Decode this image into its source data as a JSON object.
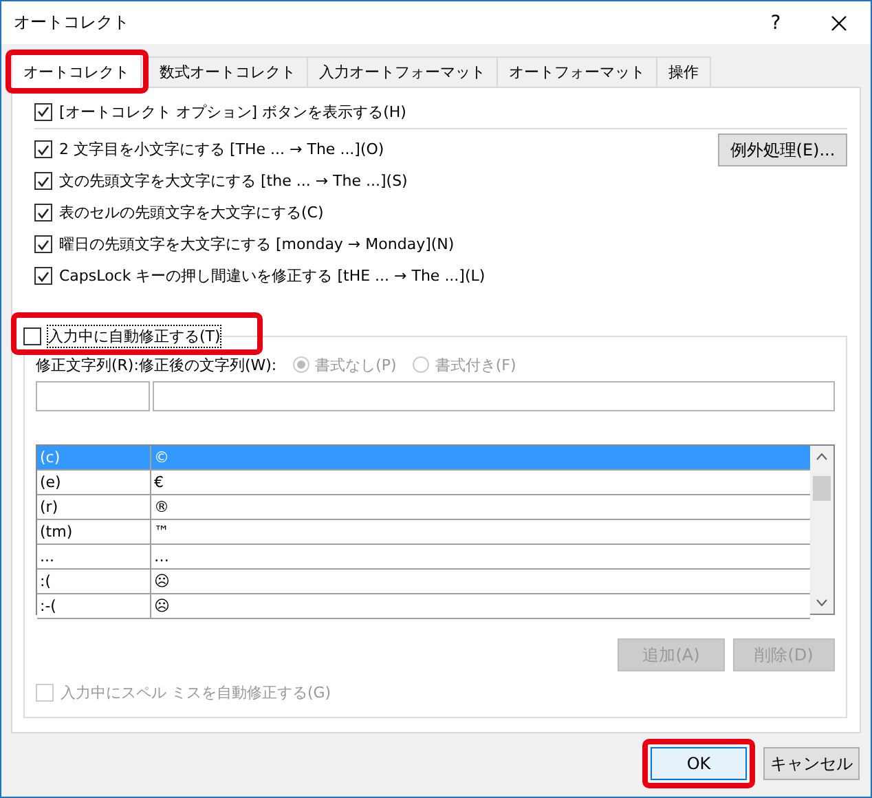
{
  "window": {
    "title": "オートコレクト",
    "help": "?"
  },
  "tabs": [
    {
      "label": "オートコレクト",
      "selected": true,
      "highlighted": true
    },
    {
      "label": "数式オートコレクト",
      "selected": false,
      "highlighted": false
    },
    {
      "label": "入力オートフォーマット",
      "selected": false,
      "highlighted": false
    },
    {
      "label": "オートフォーマット",
      "selected": false,
      "highlighted": false
    },
    {
      "label": "操作",
      "selected": false,
      "highlighted": false
    }
  ],
  "show_options_button": {
    "label": "[オートコレクト オプション] ボタンを表示する(H)",
    "checked": true
  },
  "options": [
    {
      "label": "2 文字目を小文字にする [THe ... → The ...](O)",
      "checked": true
    },
    {
      "label": "文の先頭文字を大文字にする [the ... → The ...](S)",
      "checked": true
    },
    {
      "label": "表のセルの先頭文字を大文字にする(C)",
      "checked": true
    },
    {
      "label": "曜日の先頭文字を大文字にする [monday →  Monday](N)",
      "checked": true
    },
    {
      "label": "CapsLock キーの押し間違いを修正する [tHE ... → The ...](L)",
      "checked": true
    }
  ],
  "exceptions_button": "例外処理(E)...",
  "replace_group": {
    "label": "入力中に自動修正する(T)",
    "checked": false,
    "highlighted": true,
    "replace_label": "修正文字列(R):",
    "with_label": "修正後の文字列(W):",
    "format_options": [
      {
        "label": "書式なし(P)",
        "selected": true
      },
      {
        "label": "書式付き(F)",
        "selected": false
      }
    ],
    "entries": [
      {
        "from": "(c)",
        "to": "©",
        "selected": true
      },
      {
        "from": "(e)",
        "to": "€",
        "selected": false
      },
      {
        "from": "(r)",
        "to": "®",
        "selected": false
      },
      {
        "from": "(tm)",
        "to": "™",
        "selected": false
      },
      {
        "from": "...",
        "to": "…",
        "selected": false
      },
      {
        "from": ":(",
        "to": "☹",
        "selected": false
      },
      {
        "from": ":-(",
        "to": "☹",
        "selected": false
      }
    ],
    "add_button": "追加(A)",
    "delete_button": "削除(D)",
    "spelling": {
      "label": "入力中にスペル ミスを自動修正する(G)",
      "checked": false,
      "disabled": true
    }
  },
  "buttons": [
    {
      "label": "OK",
      "highlighted": true
    },
    {
      "label": "キャンセル",
      "highlighted": false
    }
  ]
}
